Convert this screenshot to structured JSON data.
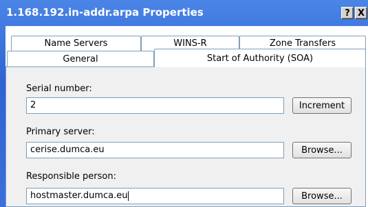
{
  "window": {
    "title": "1.168.192.in-addr.arpa Properties",
    "help_label": "?",
    "close_label": "X"
  },
  "tabs": {
    "row1": [
      "Name Servers",
      "WINS-R",
      "Zone Transfers"
    ],
    "row2": [
      "General",
      "Start of Authority (SOA)"
    ],
    "active": "Start of Authority (SOA)"
  },
  "soa": {
    "serial_label": "Serial number:",
    "serial_value": "2",
    "increment_label": "Increment",
    "primary_label": "Primary server:",
    "primary_value": "cerise.dumca.eu",
    "primary_browse": "Browse...",
    "responsible_label": "Responsible person:",
    "responsible_value": "hostmaster.dumca.eu",
    "responsible_browse": "Browse..."
  }
}
